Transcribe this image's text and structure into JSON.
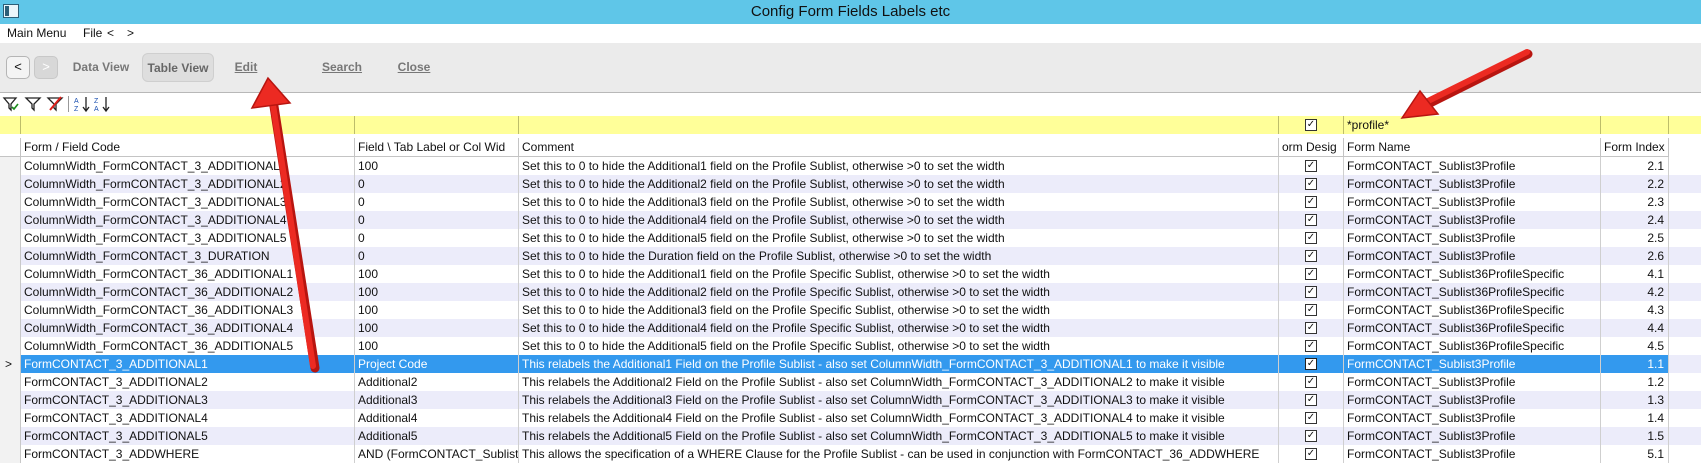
{
  "window": {
    "title": "Config Form Fields Labels etc"
  },
  "menu": {
    "items": [
      "Main Menu",
      "File",
      "<",
      ">"
    ]
  },
  "toolbar": {
    "back": "<",
    "forward": ">",
    "data_view": "Data View",
    "table_view": "Table View",
    "edit": "Edit",
    "search": "Search",
    "close": "Close"
  },
  "filter_icons": [
    "filter-apply-icon",
    "filter-icon",
    "filter-clear-icon",
    "sort-ascending-icon",
    "sort-descending-icon"
  ],
  "grid": {
    "filter": {
      "form_name": "*profile*"
    },
    "columns": [
      "Form / Field Code",
      "Field \\ Tab Label or Col Wid",
      "Comment",
      "orm Desig",
      "Form Name",
      "Form Index"
    ],
    "selected_marker": ">",
    "rows": [
      {
        "code": "ColumnWidth_FormCONTACT_3_ADDITIONAL1",
        "label": "100",
        "comment": "Set this to 0 to hide the Additional1 field on the Profile Sublist, otherwise >0 to set the width",
        "design": "☑",
        "form": "FormCONTACT_Sublist3Profile",
        "index": "2.1"
      },
      {
        "code": "ColumnWidth_FormCONTACT_3_ADDITIONAL2",
        "label": "0",
        "comment": "Set this to 0 to hide the Additional2 field on the Profile Sublist, otherwise >0 to set the width",
        "design": "☑",
        "form": "FormCONTACT_Sublist3Profile",
        "index": "2.2"
      },
      {
        "code": "ColumnWidth_FormCONTACT_3_ADDITIONAL3",
        "label": "0",
        "comment": "Set this to 0 to hide the Additional3 field on the Profile Sublist, otherwise >0 to set the width",
        "design": "☑",
        "form": "FormCONTACT_Sublist3Profile",
        "index": "2.3"
      },
      {
        "code": "ColumnWidth_FormCONTACT_3_ADDITIONAL4",
        "label": "0",
        "comment": "Set this to 0 to hide the Additional4 field on the Profile Sublist, otherwise >0 to set the width",
        "design": "☑",
        "form": "FormCONTACT_Sublist3Profile",
        "index": "2.4"
      },
      {
        "code": "ColumnWidth_FormCONTACT_3_ADDITIONAL5",
        "label": "0",
        "comment": "Set this to 0 to hide the Additional5 field on the Profile Sublist, otherwise >0 to set the width",
        "design": "☑",
        "form": "FormCONTACT_Sublist3Profile",
        "index": "2.5"
      },
      {
        "code": "ColumnWidth_FormCONTACT_3_DURATION",
        "label": "0",
        "comment": "Set this to 0 to hide the Duration field on the Profile Sublist, otherwise >0 to set the width",
        "design": "☑",
        "form": "FormCONTACT_Sublist3Profile",
        "index": "2.6"
      },
      {
        "code": "ColumnWidth_FormCONTACT_36_ADDITIONAL1",
        "label": "100",
        "comment": "Set this to 0 to hide the Additional1 field on the Profile Specific Sublist, otherwise >0 to set the width",
        "design": "☑",
        "form": "FormCONTACT_Sublist36ProfileSpecific",
        "index": "4.1"
      },
      {
        "code": "ColumnWidth_FormCONTACT_36_ADDITIONAL2",
        "label": "100",
        "comment": "Set this to 0 to hide the Additional2 field on the Profile Specific Sublist, otherwise >0 to set the width",
        "design": "☑",
        "form": "FormCONTACT_Sublist36ProfileSpecific",
        "index": "4.2"
      },
      {
        "code": "ColumnWidth_FormCONTACT_36_ADDITIONAL3",
        "label": "100",
        "comment": "Set this to 0 to hide the Additional3 field on the Profile Specific Sublist, otherwise >0 to set the width",
        "design": "☑",
        "form": "FormCONTACT_Sublist36ProfileSpecific",
        "index": "4.3"
      },
      {
        "code": "ColumnWidth_FormCONTACT_36_ADDITIONAL4",
        "label": "100",
        "comment": "Set this to 0 to hide the Additional4 field on the Profile Specific Sublist, otherwise >0 to set the width",
        "design": "☑",
        "form": "FormCONTACT_Sublist36ProfileSpecific",
        "index": "4.4"
      },
      {
        "code": "ColumnWidth_FormCONTACT_36_ADDITIONAL5",
        "label": "100",
        "comment": "Set this to 0 to hide the Additional5 field on the Profile Specific Sublist, otherwise >0 to set the width",
        "design": "☑",
        "form": "FormCONTACT_Sublist36ProfileSpecific",
        "index": "4.5"
      },
      {
        "code": "FormCONTACT_3_ADDITIONAL1",
        "label": "Project Code",
        "comment": "This relabels the Additional1 Field on the Profile Sublist - also set ColumnWidth_FormCONTACT_3_ADDITIONAL1 to make it visible",
        "design": "☑",
        "form": "FormCONTACT_Sublist3Profile",
        "index": "1.1",
        "selected": true
      },
      {
        "code": "FormCONTACT_3_ADDITIONAL2",
        "label": "Additional2",
        "comment": "This relabels the Additional2 Field on the Profile Sublist - also set ColumnWidth_FormCONTACT_3_ADDITIONAL2 to make it visible",
        "design": "☑",
        "form": "FormCONTACT_Sublist3Profile",
        "index": "1.2"
      },
      {
        "code": "FormCONTACT_3_ADDITIONAL3",
        "label": "Additional3",
        "comment": "This relabels the Additional3 Field on the Profile Sublist - also set ColumnWidth_FormCONTACT_3_ADDITIONAL3 to make it visible",
        "design": "☑",
        "form": "FormCONTACT_Sublist3Profile",
        "index": "1.3"
      },
      {
        "code": "FormCONTACT_3_ADDITIONAL4",
        "label": "Additional4",
        "comment": "This relabels the Additional4 Field on the Profile Sublist - also set ColumnWidth_FormCONTACT_3_ADDITIONAL4 to make it visible",
        "design": "☑",
        "form": "FormCONTACT_Sublist3Profile",
        "index": "1.4"
      },
      {
        "code": "FormCONTACT_3_ADDITIONAL5",
        "label": "Additional5",
        "comment": "This relabels the Additional5 Field on the Profile Sublist - also set ColumnWidth_FormCONTACT_3_ADDITIONAL5 to make it visible",
        "design": "☑",
        "form": "FormCONTACT_Sublist3Profile",
        "index": "1.5"
      },
      {
        "code": "FormCONTACT_3_ADDWHERE",
        "label": "AND (FormCONTACT_Sublist",
        "comment": "This allows the specification of a WHERE Clause for the Profile Sublist - can be used in conjunction with FormCONTACT_36_ADDWHERE",
        "design": "☑",
        "form": "FormCONTACT_Sublist3Profile",
        "index": "5.1"
      }
    ]
  },
  "colors": {
    "titlebar": "#5fc6e8",
    "filter_row": "#ffff99",
    "selected_row": "#3399ee",
    "alt_row": "#ececfa",
    "annotation_arrow": "#e8241f"
  }
}
